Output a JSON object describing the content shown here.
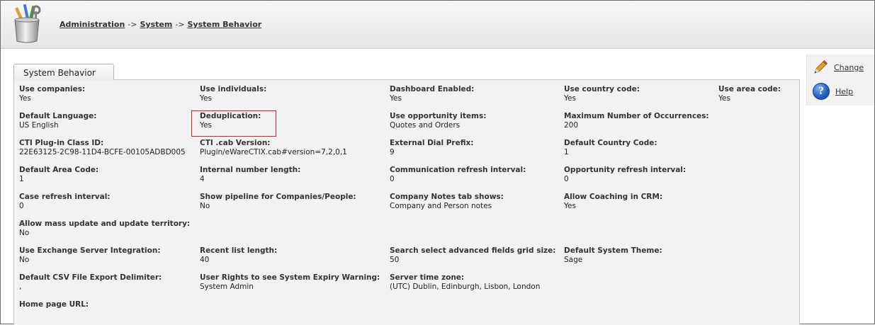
{
  "header": {
    "breadcrumb": [
      {
        "label": "Administration"
      },
      {
        "label": "System"
      },
      {
        "label": "System Behavior"
      }
    ],
    "separator": "->"
  },
  "tab": {
    "label": "System Behavior"
  },
  "fields": {
    "use_companies": {
      "label": "Use companies:",
      "value": "Yes"
    },
    "use_individuals": {
      "label": "Use individuals:",
      "value": "Yes"
    },
    "dashboard_enabled": {
      "label": "Dashboard Enabled:",
      "value": "Yes"
    },
    "use_country_code": {
      "label": "Use country code:",
      "value": "Yes"
    },
    "use_area_code": {
      "label": "Use area code:",
      "value": "Yes"
    },
    "default_language": {
      "label": "Default Language:",
      "value": "US English"
    },
    "deduplication": {
      "label": "Deduplication:",
      "value": "Yes"
    },
    "use_opportunity_items": {
      "label": "Use opportunity items:",
      "value": "Quotes and Orders"
    },
    "max_occurrences": {
      "label": "Maximum Number of Occurrences:",
      "value": "200"
    },
    "cti_plugin_class_id": {
      "label": "CTI Plug-in Class ID:",
      "value": "22E63125-2C98-11D4-BCFE-00105ADBD005"
    },
    "cti_cab_version": {
      "label": "CTI .cab Version:",
      "value": "Plugin/eWareCTIX.cab#version=7,2,0,1"
    },
    "external_dial_prefix": {
      "label": "External Dial Prefix:",
      "value": "9"
    },
    "default_country_code": {
      "label": "Default Country Code:",
      "value": "1"
    },
    "default_area_code": {
      "label": "Default Area Code:",
      "value": "1"
    },
    "internal_number_length": {
      "label": "Internal number length:",
      "value": "4"
    },
    "communication_refresh": {
      "label": "Communication refresh interval:",
      "value": "0"
    },
    "opportunity_refresh": {
      "label": "Opportunity refresh interval:",
      "value": "0"
    },
    "case_refresh": {
      "label": "Case refresh interval:",
      "value": "0"
    },
    "show_pipeline": {
      "label": "Show pipeline for Companies/People:",
      "value": "No"
    },
    "company_notes_tab": {
      "label": "Company Notes tab shows:",
      "value": "Company and Person notes"
    },
    "allow_coaching": {
      "label": "Allow Coaching in CRM:",
      "value": "Yes"
    },
    "allow_mass_update": {
      "label": "Allow mass update and update territory:",
      "value": "No"
    },
    "use_exchange": {
      "label": "Use Exchange Server Integration:",
      "value": "No"
    },
    "recent_list_length": {
      "label": "Recent list length:",
      "value": "40"
    },
    "search_grid_size": {
      "label": "Search select advanced fields grid size:",
      "value": "50"
    },
    "default_theme": {
      "label": "Default System Theme:",
      "value": "Sage"
    },
    "csv_delimiter": {
      "label": "Default CSV File Export Delimiter:",
      "value": ","
    },
    "expiry_warning_rights": {
      "label": "User Rights to see System Expiry Warning:",
      "value": "System Admin"
    },
    "server_time_zone": {
      "label": "Server time zone:",
      "value": "(UTC) Dublin, Edinburgh, Lisbon, London"
    },
    "home_page_url": {
      "label": "Home page URL:",
      "value": ""
    }
  },
  "actions": {
    "change": {
      "label": "Change",
      "icon": "pencil-icon"
    },
    "help": {
      "label": "Help",
      "icon": "help-icon"
    }
  },
  "colors": {
    "highlight_box": "#d2232a",
    "panel_bg": "#f2f2f2"
  }
}
